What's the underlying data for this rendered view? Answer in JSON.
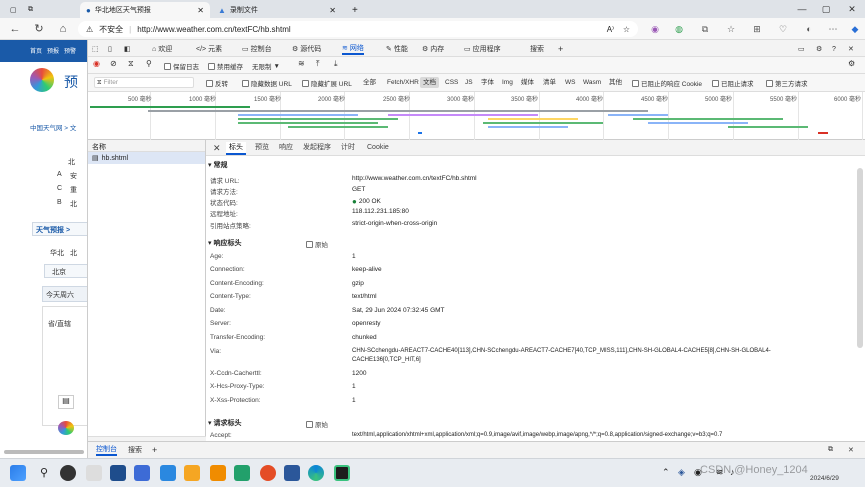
{
  "tabs": [
    {
      "title": "华北地区天气预报"
    },
    {
      "title": "录制文件"
    }
  ],
  "address": {
    "security": "不安全",
    "url": "http://www.weather.com.cn/textFC/hb.shtml"
  },
  "page": {
    "nav": [
      "首页",
      "预报",
      "预警"
    ],
    "logo_text": "预",
    "breadcrumb": "中国天气网 > 文",
    "side_labels": [
      "北",
      "A",
      "C",
      "B"
    ],
    "side_texts": [
      "安",
      "重",
      "北"
    ],
    "section_title": "天气预报 >",
    "region_tabs": [
      "华北",
      "北"
    ],
    "region_sel": "北京",
    "today": "今天周六",
    "province": "省/直辖"
  },
  "devtools": {
    "tabs": [
      "欢迎",
      "元素",
      "控制台",
      "源代码",
      "网络",
      "性能",
      "内存",
      "应用程序",
      "搜索"
    ],
    "selected_tab": "网络",
    "netbar": {
      "preserve_log": "保留日志",
      "disable_cache": "禁用缓存",
      "throttle": "无限制"
    },
    "filter": {
      "placeholder": "Filter",
      "invert": "反转",
      "hide_data_urls": "隐藏数据 URL",
      "hide_ext_urls": "隐藏扩展 URL",
      "types": [
        "全部",
        "Fetch/XHR",
        "文档",
        "CSS",
        "JS",
        "字体",
        "Img",
        "媒体",
        "清单",
        "WS",
        "Wasm",
        "其他"
      ],
      "selected_type": "文档",
      "blocked_cookies": "已阻止的响应 Cookie",
      "blocked_requests": "已阻止请求",
      "third_party": "第三方请求"
    },
    "timeline_ticks": [
      "500 毫秒",
      "1000 毫秒",
      "1500 毫秒",
      "2000 毫秒",
      "2500 毫秒",
      "3000 毫秒",
      "3500 毫秒",
      "4000 毫秒",
      "4500 毫秒",
      "5000 毫秒",
      "5500 毫秒",
      "6000 毫秒"
    ],
    "request_list": {
      "header": "名称",
      "file": "hb.shtml"
    },
    "detail_tabs": [
      "标头",
      "预览",
      "响应",
      "发起程序",
      "计时",
      "Cookie"
    ],
    "selected_detail_tab": "标头",
    "general": {
      "title": "常规",
      "rows": [
        {
          "k": "请求 URL:",
          "v": "http://www.weather.com.cn/textFC/hb.shtml"
        },
        {
          "k": "请求方法:",
          "v": "GET"
        },
        {
          "k": "状态代码:",
          "v": "200 OK"
        },
        {
          "k": "远程地址:",
          "v": "118.112.231.185:80"
        },
        {
          "k": "引用站点策略:",
          "v": "strict-origin-when-cross-origin"
        }
      ]
    },
    "response_headers": {
      "title": "响应标头",
      "raw": "原始",
      "rows": [
        {
          "k": "Age:",
          "v": "1"
        },
        {
          "k": "Connection:",
          "v": "keep-alive"
        },
        {
          "k": "Content-Encoding:",
          "v": "gzip"
        },
        {
          "k": "Content-Type:",
          "v": "text/html"
        },
        {
          "k": "Date:",
          "v": "Sat, 29 Jun 2024 07:32:45 GMT"
        },
        {
          "k": "Server:",
          "v": "openresty"
        },
        {
          "k": "Transfer-Encoding:",
          "v": "chunked"
        },
        {
          "k": "Via:",
          "v": "CHN-SCchengdu-AREACT7-CACHE40[113],CHN-SCchengdu-AREACT7-CACHE7[40,TCP_MISS,111],CHN-SH-GLOBAL4-CACHE5[8],CHN-SH-GLOBAL4-",
          "v2": "CACHE136[0,TCP_HIT,6]"
        },
        {
          "k": "X-Ccdn-Cacherttl:",
          "v": "1200"
        },
        {
          "k": "X-Hcs-Proxy-Type:",
          "v": "1"
        },
        {
          "k": "X-Xss-Protection:",
          "v": "1"
        }
      ]
    },
    "request_headers": {
      "title": "请求标头",
      "raw": "原始",
      "rows": [
        {
          "k": "Accept:",
          "v": "text/html,application/xhtml+xml,application/xml;q=0.9,image/avif,image/webp,image/apng,*/*;q=0.8,application/signed-exchange;v=b3;q=0.7"
        }
      ]
    },
    "status": "1 /61 次请求  已传输27.2 kB/1.6 MB  3",
    "drawer_tabs": [
      "控制台",
      "搜索"
    ]
  },
  "taskbar": {
    "watermark": "CSDN @Honey_1204",
    "date": "2024/6/29"
  }
}
